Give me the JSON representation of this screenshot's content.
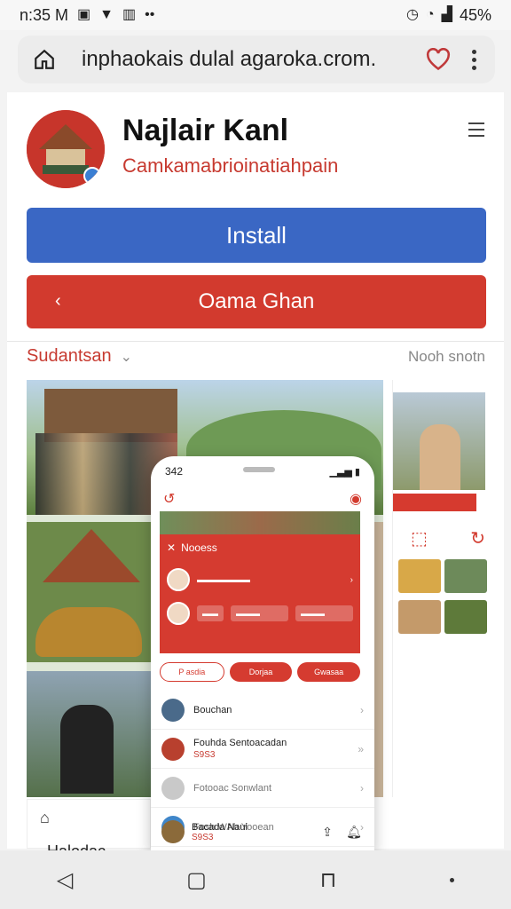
{
  "status_bar": {
    "time": "n:35 M",
    "battery": "45%"
  },
  "browser": {
    "url": "inphaokais dulal agaroka.crom."
  },
  "app": {
    "name": "Najlair Kanl",
    "subtitle": "Camkamabrioinatiahpain",
    "install_label": "Install",
    "secondary_button_label": "Oama Ghan"
  },
  "section": {
    "left_label": "Sudantsan",
    "right_label": "Nooh snotn"
  },
  "phone": {
    "status_time": "342",
    "header_label": "Nooess",
    "chips": [
      "P asdia",
      "Dorjaa",
      "Gwasaa"
    ],
    "list": [
      {
        "title": "Bouchan",
        "sub": ""
      },
      {
        "title": "Fouhda Sentoacadan",
        "sub": "S9S3"
      },
      {
        "title": "Fotooac Sonwlant",
        "sub": ""
      },
      {
        "title": "Fosh WAh Yooean",
        "sub": ""
      }
    ],
    "footer": {
      "title": "Bacada Naui",
      "sub": "S9S3"
    }
  },
  "bottom_card": {
    "label": "Halodac"
  },
  "icons": {
    "status_left": [
      "image-icon",
      "shield-icon",
      "wifi-icon",
      "book-icon"
    ],
    "status_right": [
      "alarm-icon",
      "wifi-icon",
      "signal-icon",
      "battery-icon"
    ],
    "url_bar": [
      "home-icon",
      "heart-icon",
      "more-icon"
    ],
    "nav_bar": [
      "back-icon",
      "home-icon",
      "bookmarks-icon",
      "more-icon"
    ]
  },
  "colors": {
    "install_blue": "#3a67c4",
    "accent_red": "#d23a2e"
  }
}
